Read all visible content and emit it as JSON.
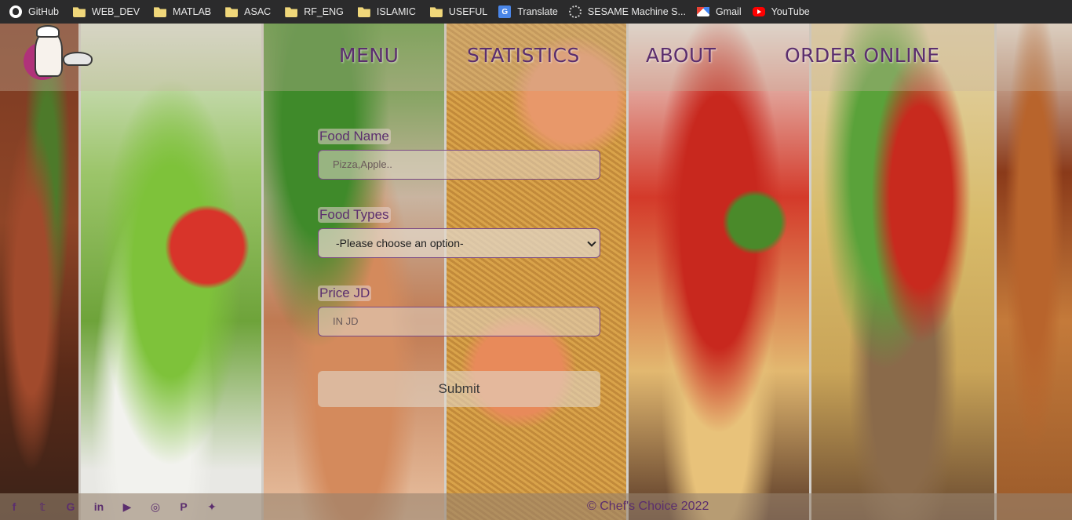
{
  "bookmarks": [
    {
      "label": "GitHub",
      "icon": "github-icon"
    },
    {
      "label": "WEB_DEV",
      "icon": "folder-icon"
    },
    {
      "label": "MATLAB",
      "icon": "folder-icon"
    },
    {
      "label": "ASAC",
      "icon": "folder-icon"
    },
    {
      "label": "RF_ENG",
      "icon": "folder-icon"
    },
    {
      "label": "ISLAMIC",
      "icon": "folder-icon"
    },
    {
      "label": "USEFUL",
      "icon": "folder-icon"
    },
    {
      "label": "Translate",
      "icon": "translate-icon"
    },
    {
      "label": "SESAME Machine S...",
      "icon": "sesame-icon"
    },
    {
      "label": "Gmail",
      "icon": "gmail-icon"
    },
    {
      "label": "YouTube",
      "icon": "youtube-icon"
    }
  ],
  "nav": {
    "menu": "MENU",
    "statistics": "STATISTICS",
    "about": "ABOUT",
    "order_online": "ORDER ONLINE"
  },
  "form": {
    "food_name_label": "Food Name",
    "food_name_placeholder": "Pizza,Apple..",
    "food_types_label": "Food Types",
    "food_types_selected": "-Please choose an option-",
    "price_label": "Price JD",
    "price_placeholder": "IN JD",
    "submit_label": "Submit"
  },
  "footer": {
    "social_icons": [
      "facebook-icon",
      "twitter-icon",
      "google-icon",
      "linkedin-icon",
      "youtube-icon",
      "instagram-icon",
      "pinterest-icon",
      "snapchat-icon"
    ],
    "social_glyphs": [
      "f",
      "𝕥",
      "G",
      "in",
      "▶",
      "◎",
      "P",
      "✦"
    ],
    "copyright": "© Chef's Choice 2022"
  },
  "colors": {
    "accent": "#5b2e6e",
    "bookmarks_bar": "#2b2b2c"
  }
}
